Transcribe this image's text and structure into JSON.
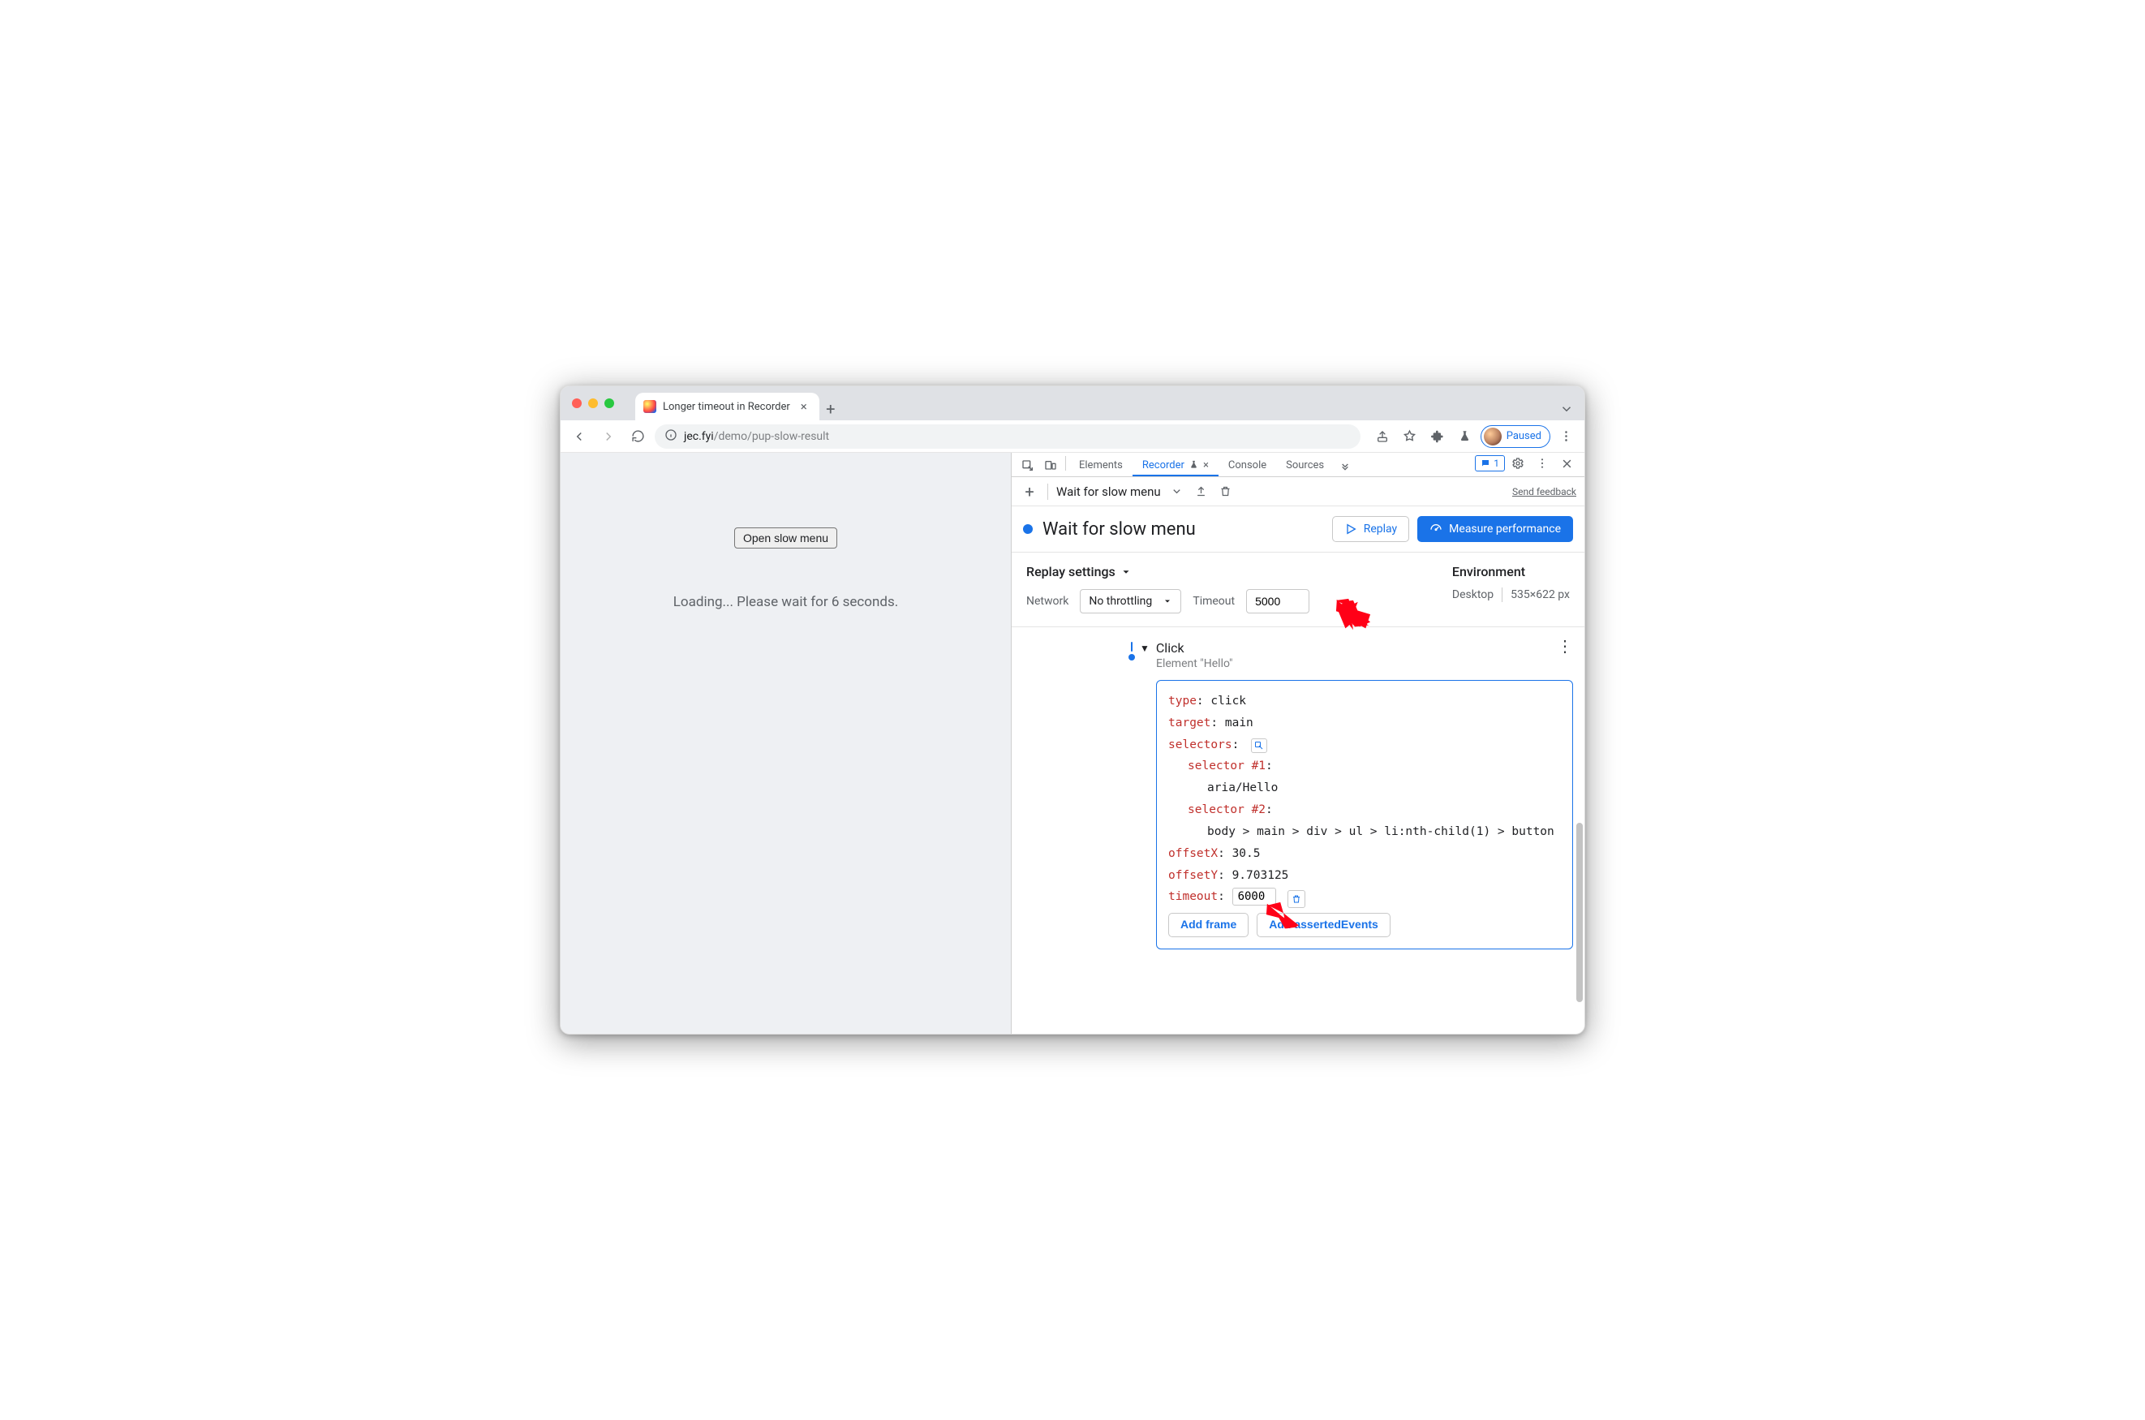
{
  "browser": {
    "tab_title": "Longer timeout in Recorder",
    "url_host": "jec.fyi",
    "url_path": "/demo/pup-slow-result",
    "profile_status": "Paused"
  },
  "page": {
    "button_label": "Open slow menu",
    "loading_text": "Loading... Please wait for 6 seconds."
  },
  "devtools": {
    "tabs": {
      "elements": "Elements",
      "recorder": "Recorder",
      "console": "Console",
      "sources": "Sources"
    },
    "issue_count": "1"
  },
  "recorder": {
    "toolbar": {
      "title": "Wait for slow menu",
      "feedback": "Send feedback"
    },
    "header": {
      "title": "Wait for slow menu",
      "replay_label": "Replay",
      "measure_label": "Measure performance"
    },
    "settings": {
      "title": "Replay settings",
      "network_label": "Network",
      "network_value": "No throttling",
      "timeout_label": "Timeout",
      "timeout_value": "5000"
    },
    "environment": {
      "title": "Environment",
      "device": "Desktop",
      "dimensions": "535×622 px"
    },
    "step": {
      "title": "Click",
      "subtitle": "Element \"Hello\"",
      "type_key": "type",
      "type_val": "click",
      "target_key": "target",
      "target_val": "main",
      "selectors_key": "selectors",
      "sel1_key": "selector #1",
      "sel1_val": "aria/Hello",
      "sel2_key": "selector #2",
      "sel2_val": "body > main > div > ul > li:nth-child(1) > button",
      "offx_key": "offsetX",
      "offx_val": "30.5",
      "offy_key": "offsetY",
      "offy_val": "9.703125",
      "timeout_key": "timeout",
      "timeout_val": "6000",
      "add_frame": "Add frame",
      "add_asserted": "Add assertedEvents"
    }
  }
}
